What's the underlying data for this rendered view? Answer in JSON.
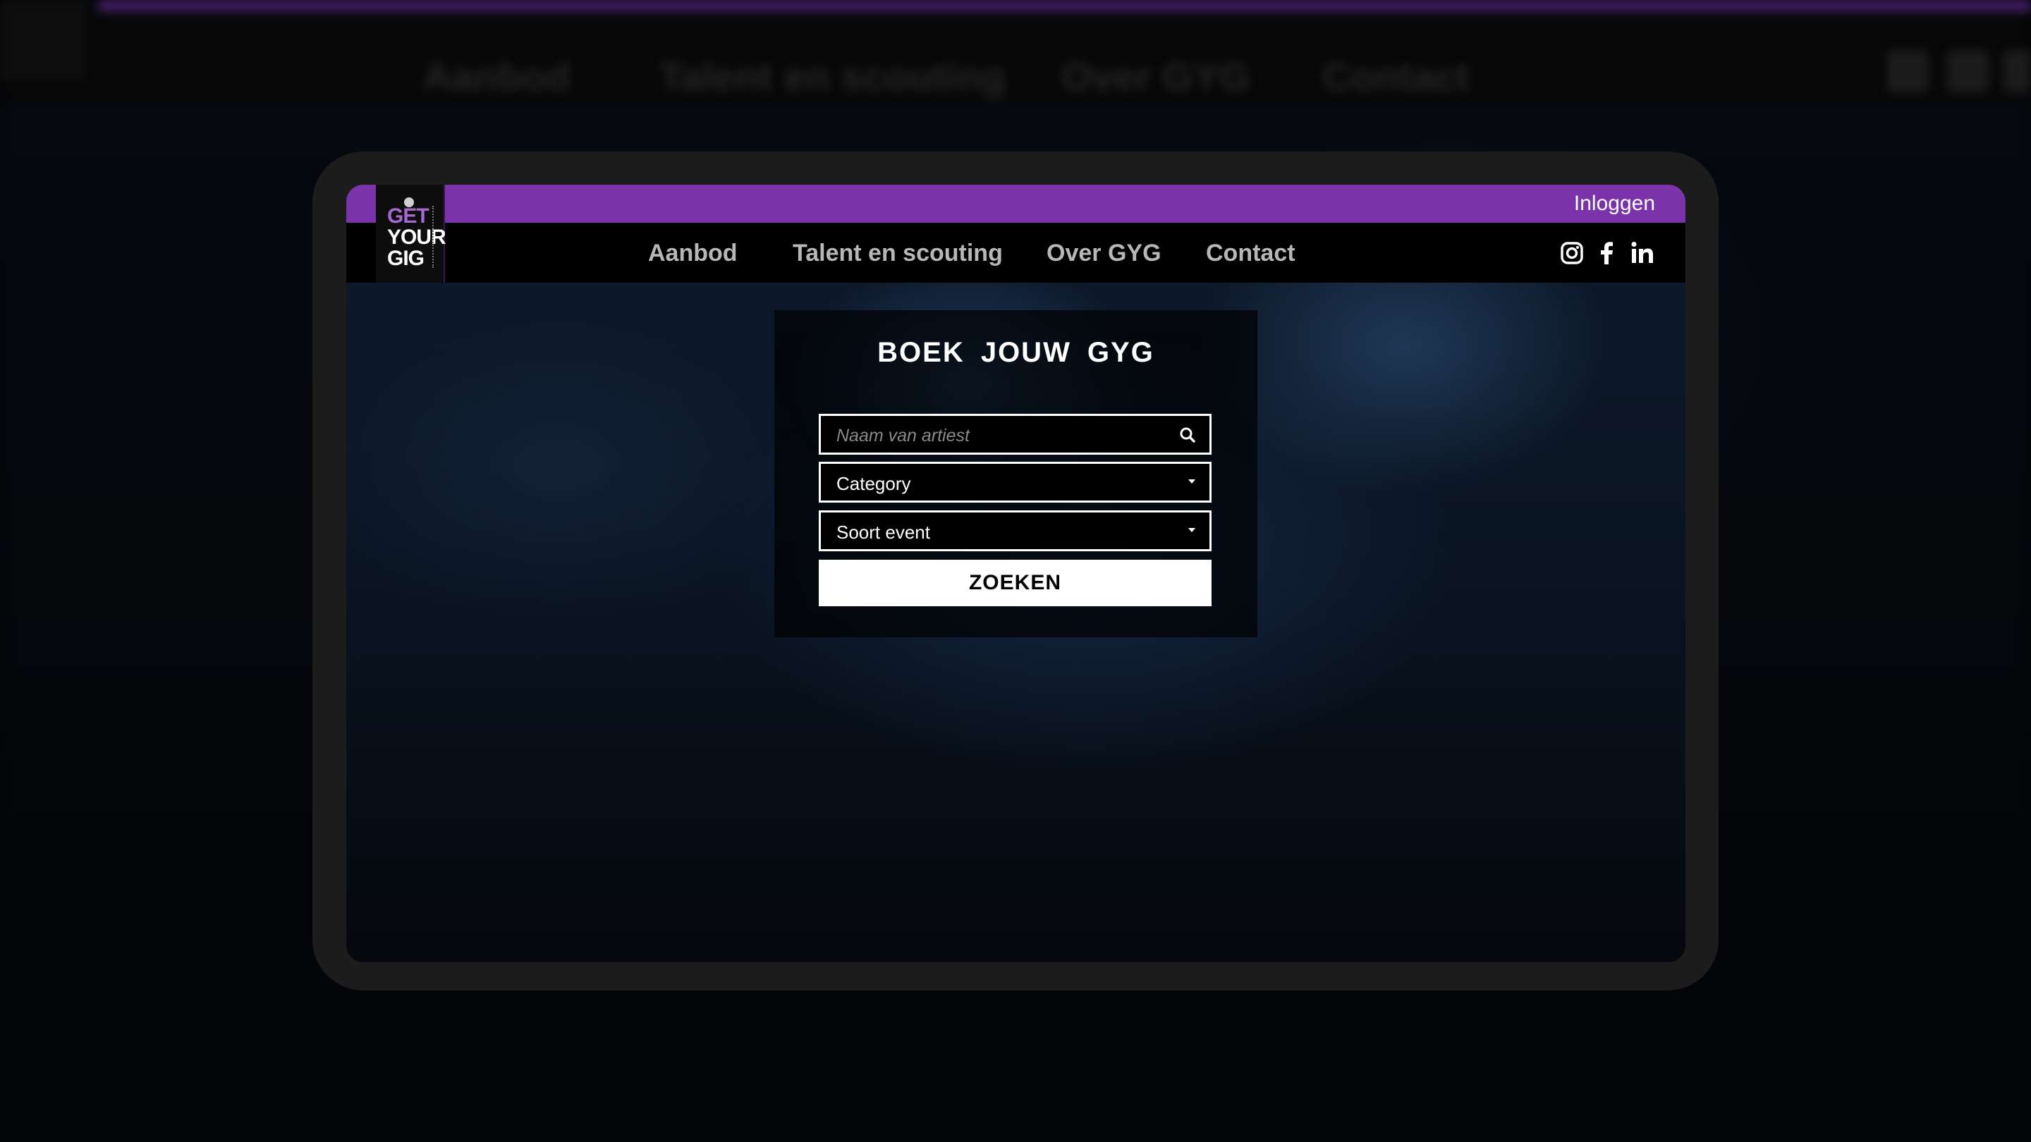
{
  "background_page": {
    "nav_links": [
      "Aanbod",
      "Talent en scouting",
      "Over GYG",
      "Contact"
    ]
  },
  "header": {
    "login_label": "Inloggen",
    "logo_text": [
      "GET",
      "YOUR",
      "GIG"
    ],
    "nav_links": [
      "Aanbod",
      "Talent en scouting",
      "Over GYG",
      "Contact"
    ],
    "social_icons": [
      "instagram-icon",
      "facebook-icon",
      "linkedin-icon"
    ]
  },
  "search": {
    "title": "BOEK JOUW GYG",
    "artist_placeholder": "Naam van artiest",
    "category_value": "Category",
    "event_value": "Soort event",
    "submit_label": "ZOEKEN"
  },
  "colors": {
    "accent_purple": "#7a33a8",
    "nav_background": "#000000",
    "frame": "#1c1c1c"
  }
}
